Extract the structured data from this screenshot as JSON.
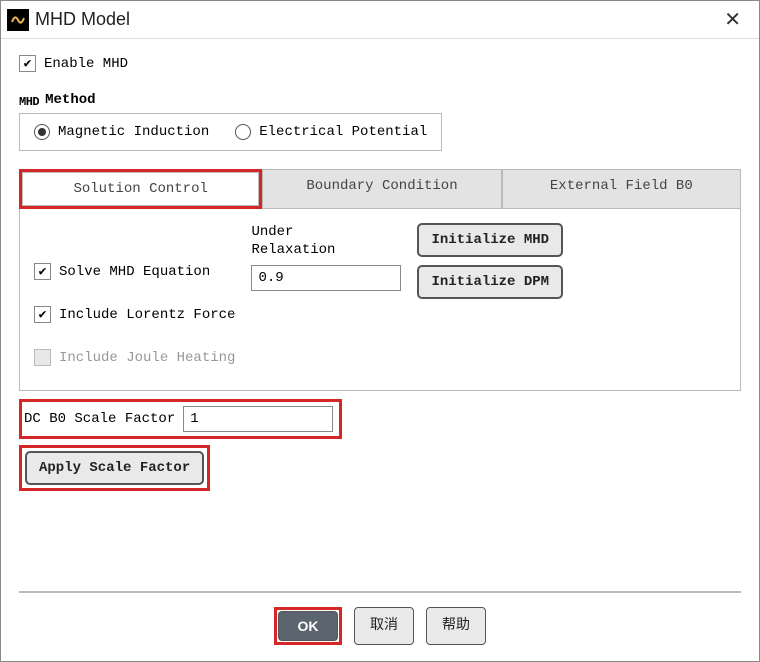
{
  "titlebar": {
    "title": "MHD Model"
  },
  "enable": {
    "label": "Enable MHD",
    "checked": true
  },
  "method": {
    "prefix": "MHD",
    "label": "Method",
    "options": {
      "magnetic_induction": "Magnetic Induction",
      "electrical_potential": "Electrical Potential"
    },
    "selected": "magnetic_induction"
  },
  "tabs": {
    "solution_control": "Solution Control",
    "boundary_condition": "Boundary Condition",
    "external_field": "External Field B0",
    "active": "solution_control"
  },
  "solution_panel": {
    "solve_mhd": {
      "label": "Solve MHD Equation",
      "checked": true
    },
    "include_lorentz": {
      "label": "Include Lorentz Force",
      "checked": true
    },
    "include_joule": {
      "label": "Include Joule Heating",
      "checked": false,
      "disabled": true
    },
    "under_relaxation": {
      "label": "Under\nRelaxation",
      "value": "0.9"
    },
    "initialize_mhd": "Initialize MHD",
    "initialize_dpm": "Initialize DPM"
  },
  "dc_scale": {
    "label": "DC B0 Scale Factor",
    "value": "1",
    "apply_label": "Apply Scale Factor"
  },
  "footer": {
    "ok": "OK",
    "cancel": "取消",
    "help": "帮助"
  }
}
